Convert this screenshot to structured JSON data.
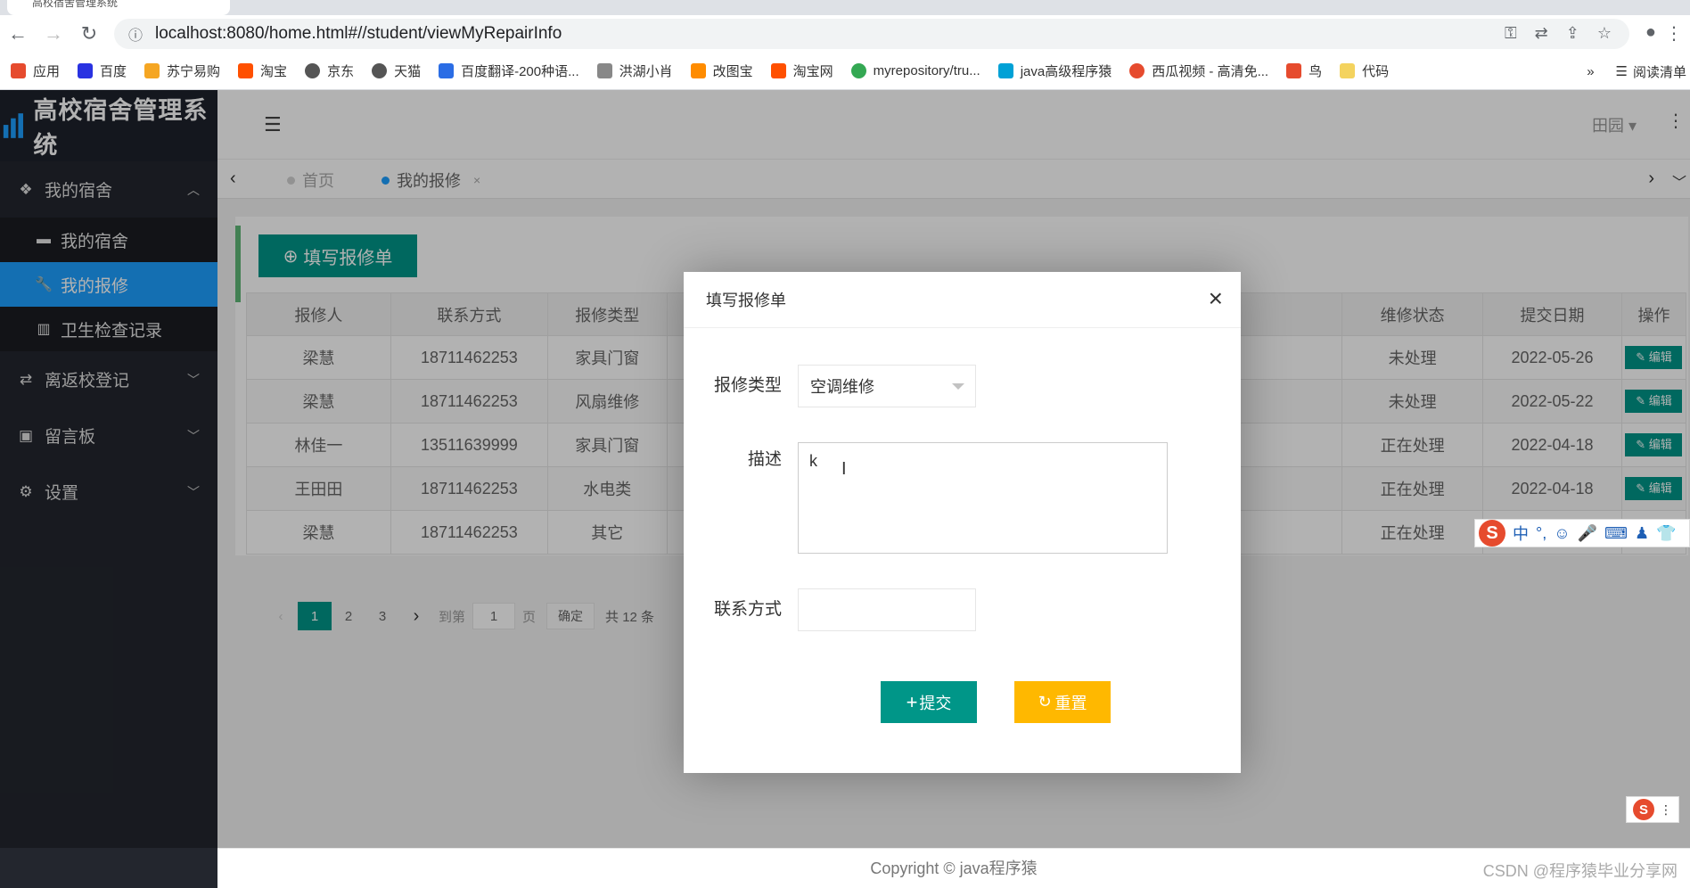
{
  "browser": {
    "tab_title": "高校宿舍管理系统",
    "url": "localhost:8080/home.html#//student/viewMyRepairInfo",
    "bookmarks": [
      {
        "label": "应用",
        "color": "#e64b2e"
      },
      {
        "label": "百度",
        "color": "#2932e1"
      },
      {
        "label": "苏宁易购",
        "color": "#f5a623"
      },
      {
        "label": "淘宝",
        "color": "#ff5000"
      },
      {
        "label": "京东",
        "color": "#555555"
      },
      {
        "label": "天猫",
        "color": "#555555"
      },
      {
        "label": "百度翻译-200种语...",
        "color": "#2b6de5"
      },
      {
        "label": "洪湖小肖",
        "color": "#888888"
      },
      {
        "label": "改图宝",
        "color": "#ff8c00"
      },
      {
        "label": "淘宝网",
        "color": "#ff5000"
      },
      {
        "label": "myrepository/tru...",
        "color": "#34a853"
      },
      {
        "label": "java高级程序猿",
        "color": "#00a1d6"
      },
      {
        "label": "西瓜视频 - 高清免...",
        "color": "#e64b2e"
      },
      {
        "label": "鸟",
        "color": "#e64b2e"
      },
      {
        "label": "代码",
        "color": "#f4d35e"
      }
    ],
    "reading_list": "阅读清单"
  },
  "app": {
    "title": "高校宿舍管理系统",
    "user": "田园",
    "menu": {
      "dorm": "我的宿舍",
      "sub_dorm": "我的宿舍",
      "sub_repair": "我的报修",
      "sub_hygiene": "卫生检查记录",
      "leave": "离返校登记",
      "board": "留言板",
      "settings": "设置"
    },
    "tabs": {
      "home": "首页",
      "current": "我的报修"
    },
    "add_button": "填写报修单",
    "table": {
      "headers": [
        "报修人",
        "联系方式",
        "报修类型",
        "维修状态",
        "提交日期",
        "操作"
      ],
      "rows": [
        [
          "梁慧",
          "18711462253",
          "家具门窗",
          "未处理",
          "2022-05-26"
        ],
        [
          "梁慧",
          "18711462253",
          "风扇维修",
          "未处理",
          "2022-05-22"
        ],
        [
          "林佳一",
          "13511639999",
          "家具门窗",
          "正在处理",
          "2022-04-18"
        ],
        [
          "王田田",
          "18711462253",
          "水电类",
          "正在处理",
          "2022-04-18"
        ],
        [
          "梁慧",
          "18711462253",
          "其它",
          "正在处理",
          "2022-04-18"
        ]
      ],
      "edit_label": "编辑"
    },
    "pager": {
      "p1": "1",
      "p2": "2",
      "p3": "3",
      "goto": "到第",
      "page_value": "1",
      "page_unit": "页",
      "ok": "确定",
      "total": "共 12 条"
    },
    "footer": "Copyright © java程序猿",
    "watermark": "CSDN @程序猿毕业分享网"
  },
  "modal": {
    "title": "填写报修单",
    "type_label": "报修类型",
    "type_value": "空调维修",
    "desc_label": "描述",
    "desc_value": "k",
    "contact_label": "联系方式",
    "contact_value": "",
    "submit": "提交",
    "reset": "重置"
  },
  "ime": {
    "mode": "中"
  }
}
